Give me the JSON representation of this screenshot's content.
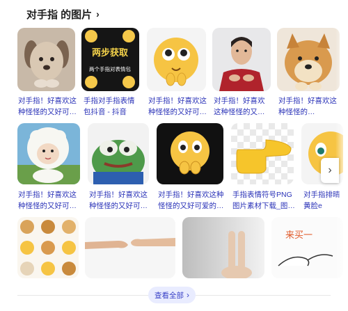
{
  "header": {
    "title": "对手指 的图片",
    "chevron_icon": "chevron-right-icon"
  },
  "row1": [
    {
      "caption": "对手指！好喜欢这种怪怪的又好可…"
    },
    {
      "caption": "手指对手指表情包抖音 - 抖音",
      "overlay_top": "两步获取",
      "overlay_bottom": "两个手指对表情包"
    },
    {
      "caption": "对手指！好喜欢这种怪怪的又好可…"
    },
    {
      "caption": "对手指！好喜欢这种怪怪的又…"
    },
    {
      "caption": "对手指！好喜欢这种怪怪的…"
    }
  ],
  "row2": [
    {
      "caption": "对手指！好喜欢这种怪怪的又好可…"
    },
    {
      "caption": "对手指！好喜欢这种怪怪的又好可…"
    },
    {
      "caption": "对手指！好喜欢这种怪怪的又好可爱的…"
    },
    {
      "caption": "手指表情符号PNG图片素材下载_图…"
    },
    {
      "caption": "对手指排晴黄脸e"
    }
  ],
  "row3": [
    {
      "caption": ""
    },
    {
      "caption": ""
    },
    {
      "caption": ""
    },
    {
      "caption": "",
      "overlay_text": "来买一"
    }
  ],
  "view_all": {
    "label": "查看全部",
    "icon": "chevron-right-icon"
  },
  "next_button": {
    "icon": "chevron-right-icon"
  },
  "colors": {
    "link": "#2b33b8",
    "pill_bg": "#e9ecff"
  }
}
